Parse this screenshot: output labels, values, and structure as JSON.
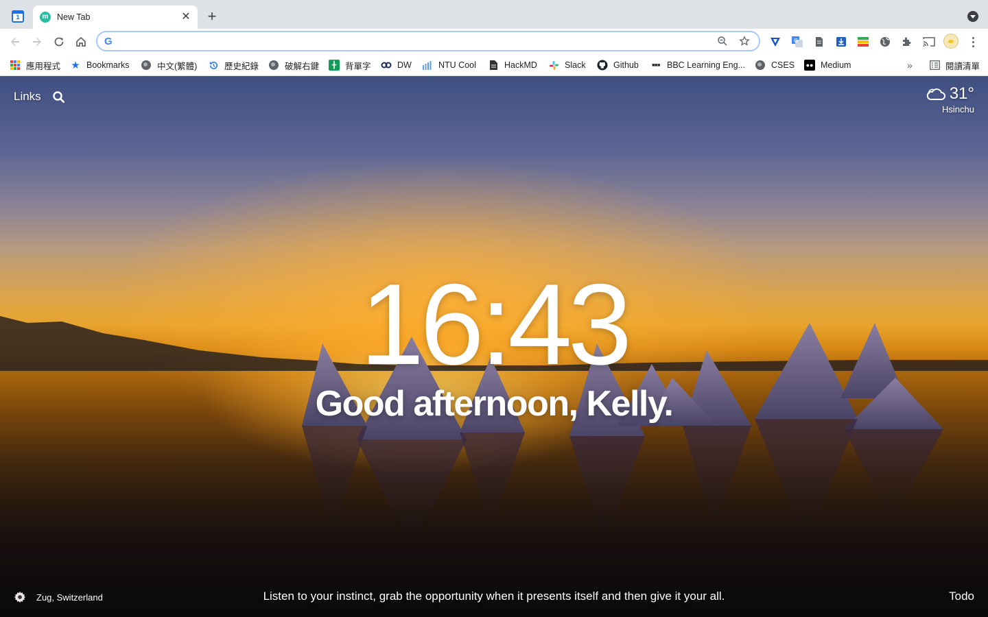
{
  "browser": {
    "tab": {
      "title": "New Tab",
      "favicon_letter": "m"
    },
    "pinned_tab_icon": "calendar-icon",
    "omnibox": {
      "value": "",
      "placeholder": ""
    },
    "bookmarks": [
      {
        "label": "應用程式",
        "icon": "apps-grid-icon"
      },
      {
        "label": "Bookmarks",
        "icon": "star-icon"
      },
      {
        "label": "中文(繁體)",
        "icon": "globe-icon"
      },
      {
        "label": "歷史紀錄",
        "icon": "history-icon"
      },
      {
        "label": "破解右鍵",
        "icon": "globe-icon"
      },
      {
        "label": "背單字",
        "icon": "sheets-icon"
      },
      {
        "label": "DW",
        "icon": "dw-icon"
      },
      {
        "label": "NTU Cool",
        "icon": "ntu-cool-icon"
      },
      {
        "label": "HackMD",
        "icon": "document-icon"
      },
      {
        "label": "Slack",
        "icon": "slack-icon"
      },
      {
        "label": "Github",
        "icon": "github-icon"
      },
      {
        "label": "BBC Learning Eng...",
        "icon": "bbc-icon"
      },
      {
        "label": "CSES",
        "icon": "globe-icon"
      },
      {
        "label": "Medium",
        "icon": "medium-icon"
      }
    ],
    "overflow_label": "»",
    "reading_list_label": "閱讀清單"
  },
  "momentum": {
    "links_label": "Links",
    "weather": {
      "temp": "31°",
      "city": "Hsinchu",
      "condition_icon": "cloud-icon"
    },
    "clock": "16:43",
    "greeting": "Good afternoon, Kelly.",
    "location": "Zug, Switzerland",
    "quote": "Listen to your instinct, grab the opportunity when it presents itself and then give it your all.",
    "todo_label": "Todo"
  },
  "colors": {
    "accent_blue": "#1a73e8",
    "omnibox_border": "#a8c7fa",
    "toolbar_bg": "#ffffff",
    "tabstrip_bg": "#dee1e6"
  }
}
